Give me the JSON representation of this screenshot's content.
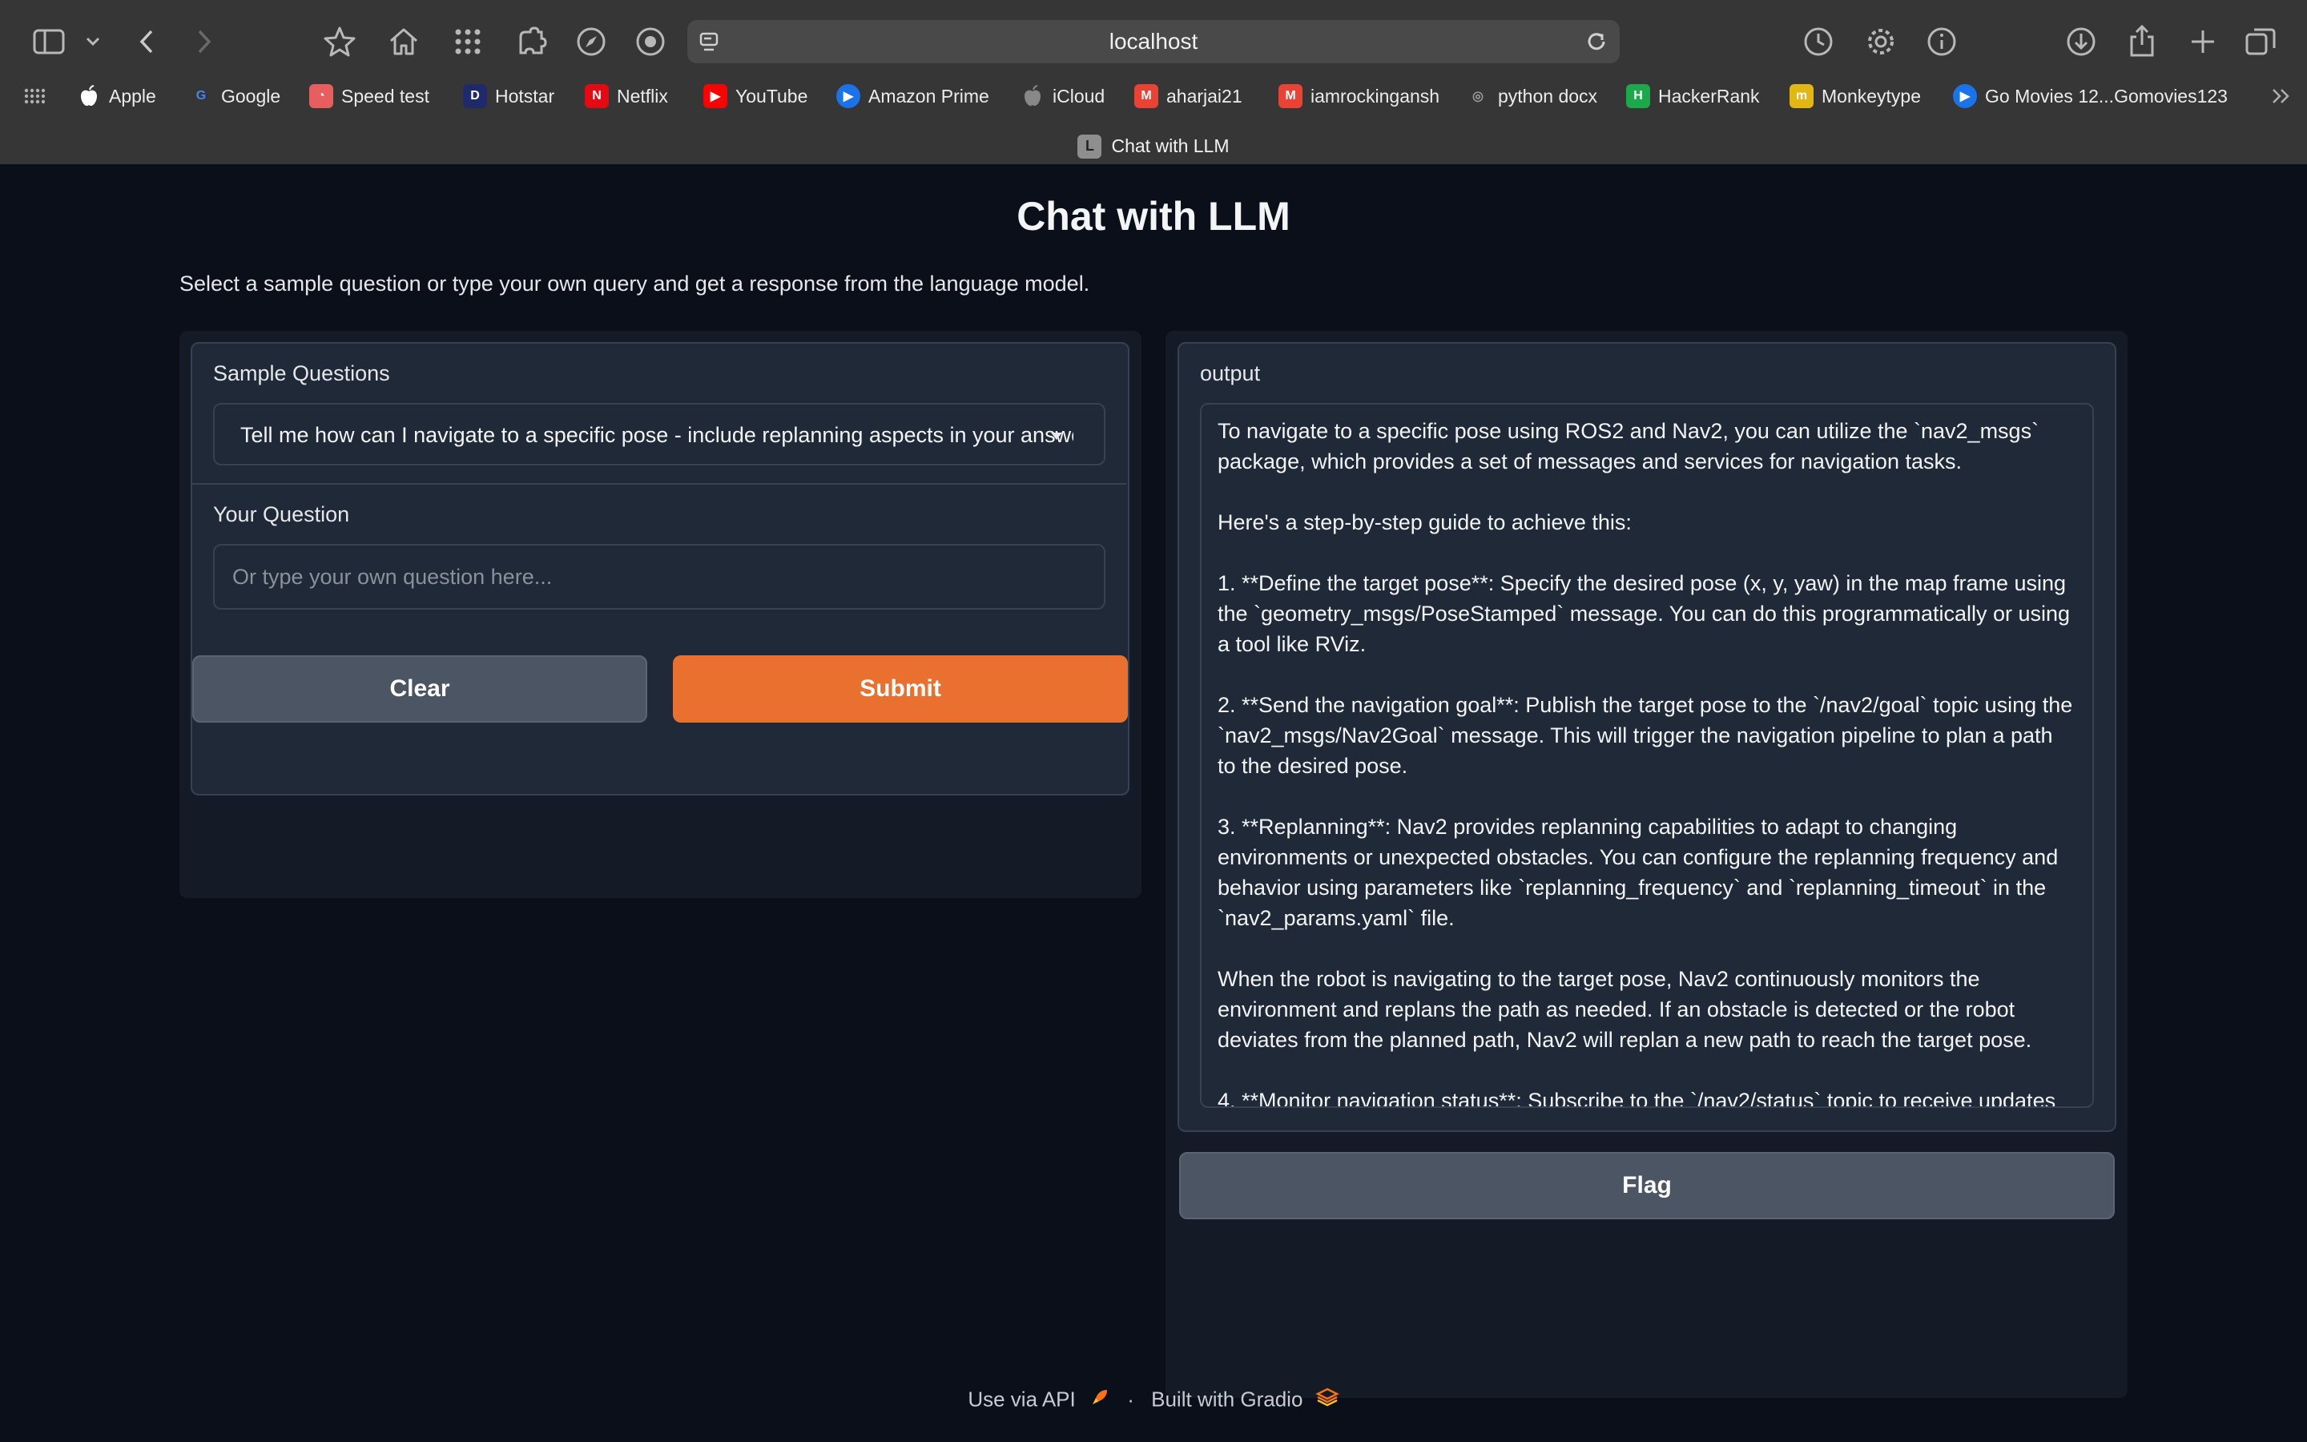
{
  "browser": {
    "url": "localhost",
    "tab_title": "Chat with LLM",
    "tab_favicon_letter": "L",
    "bookmarks": [
      {
        "label": "Apple",
        "icon": "apple-icon",
        "color": "#ffffff"
      },
      {
        "label": "Google",
        "icon": "google-icon",
        "color": "#4285f4"
      },
      {
        "label": "Speed test",
        "icon": "speedometer-icon",
        "color": "#e85d5d"
      },
      {
        "label": "Hotstar",
        "icon": "hotstar-icon",
        "color": "#1f2a6b"
      },
      {
        "label": "Netflix",
        "icon": "netflix-icon",
        "color": "#e50914"
      },
      {
        "label": "YouTube",
        "icon": "youtube-icon",
        "color": "#ff0000"
      },
      {
        "label": "Amazon Prime",
        "icon": "play-icon",
        "color": "#1a73e8"
      },
      {
        "label": "iCloud",
        "icon": "apple-icon",
        "color": "#888888"
      },
      {
        "label": "aharjai21",
        "icon": "gmail-icon",
        "color": "#ea4335"
      },
      {
        "label": "iamrockingansh",
        "icon": "gmail-icon",
        "color": "#ea4335"
      },
      {
        "label": "python docx",
        "icon": "globe-icon",
        "color": "#9a9a9a"
      },
      {
        "label": "HackerRank",
        "icon": "hackerrank-icon",
        "color": "#1ba94c"
      },
      {
        "label": "Monkeytype",
        "icon": "monkeytype-icon",
        "color": "#e2b714"
      },
      {
        "label": "Go Movies 12...Gomovies123",
        "icon": "play-icon",
        "color": "#1a73e8"
      }
    ]
  },
  "page": {
    "title": "Chat with LLM",
    "description": "Select a sample question or type your own query and get a response from the language model."
  },
  "form": {
    "sample_label": "Sample Questions",
    "sample_value": "Tell me how can I navigate to a specific pose - include replanning aspects in your answer.",
    "question_label": "Your Question",
    "question_placeholder": "Or type your own question here...",
    "clear_label": "Clear",
    "submit_label": "Submit"
  },
  "output": {
    "label": "output",
    "paragraphs": [
      "To navigate to a specific pose using ROS2 and Nav2, you can utilize the `nav2_msgs` package, which provides a set of messages and services for navigation tasks.",
      "Here's a step-by-step guide to achieve this:",
      "1. **Define the target pose**: Specify the desired pose (x, y, yaw) in the map frame using the `geometry_msgs/PoseStamped` message. You can do this programmatically or using a tool like RViz.",
      "2. **Send the navigation goal**: Publish the target pose to the `/nav2/goal` topic using the `nav2_msgs/Nav2Goal` message. This will trigger the navigation pipeline to plan a path to the desired pose.",
      "3. **Replanning**: Nav2 provides replanning capabilities to adapt to changing environments or unexpected obstacles. You can configure the replanning frequency and behavior using parameters like `replanning_frequency` and `replanning_timeout` in the `nav2_params.yaml` file.",
      "When the robot is navigating to the target pose, Nav2 continuously monitors the environment and replans the path as needed. If an obstacle is detected or the robot deviates from the planned path, Nav2 will replan a new path to reach the target pose.",
      "4. **Monitor navigation status**: Subscribe to the `/nav2/status` topic to receive updates"
    ],
    "flag_label": "Flag"
  },
  "footer": {
    "api_label": "Use via API",
    "separator": "·",
    "built_label": "Built with Gradio"
  }
}
